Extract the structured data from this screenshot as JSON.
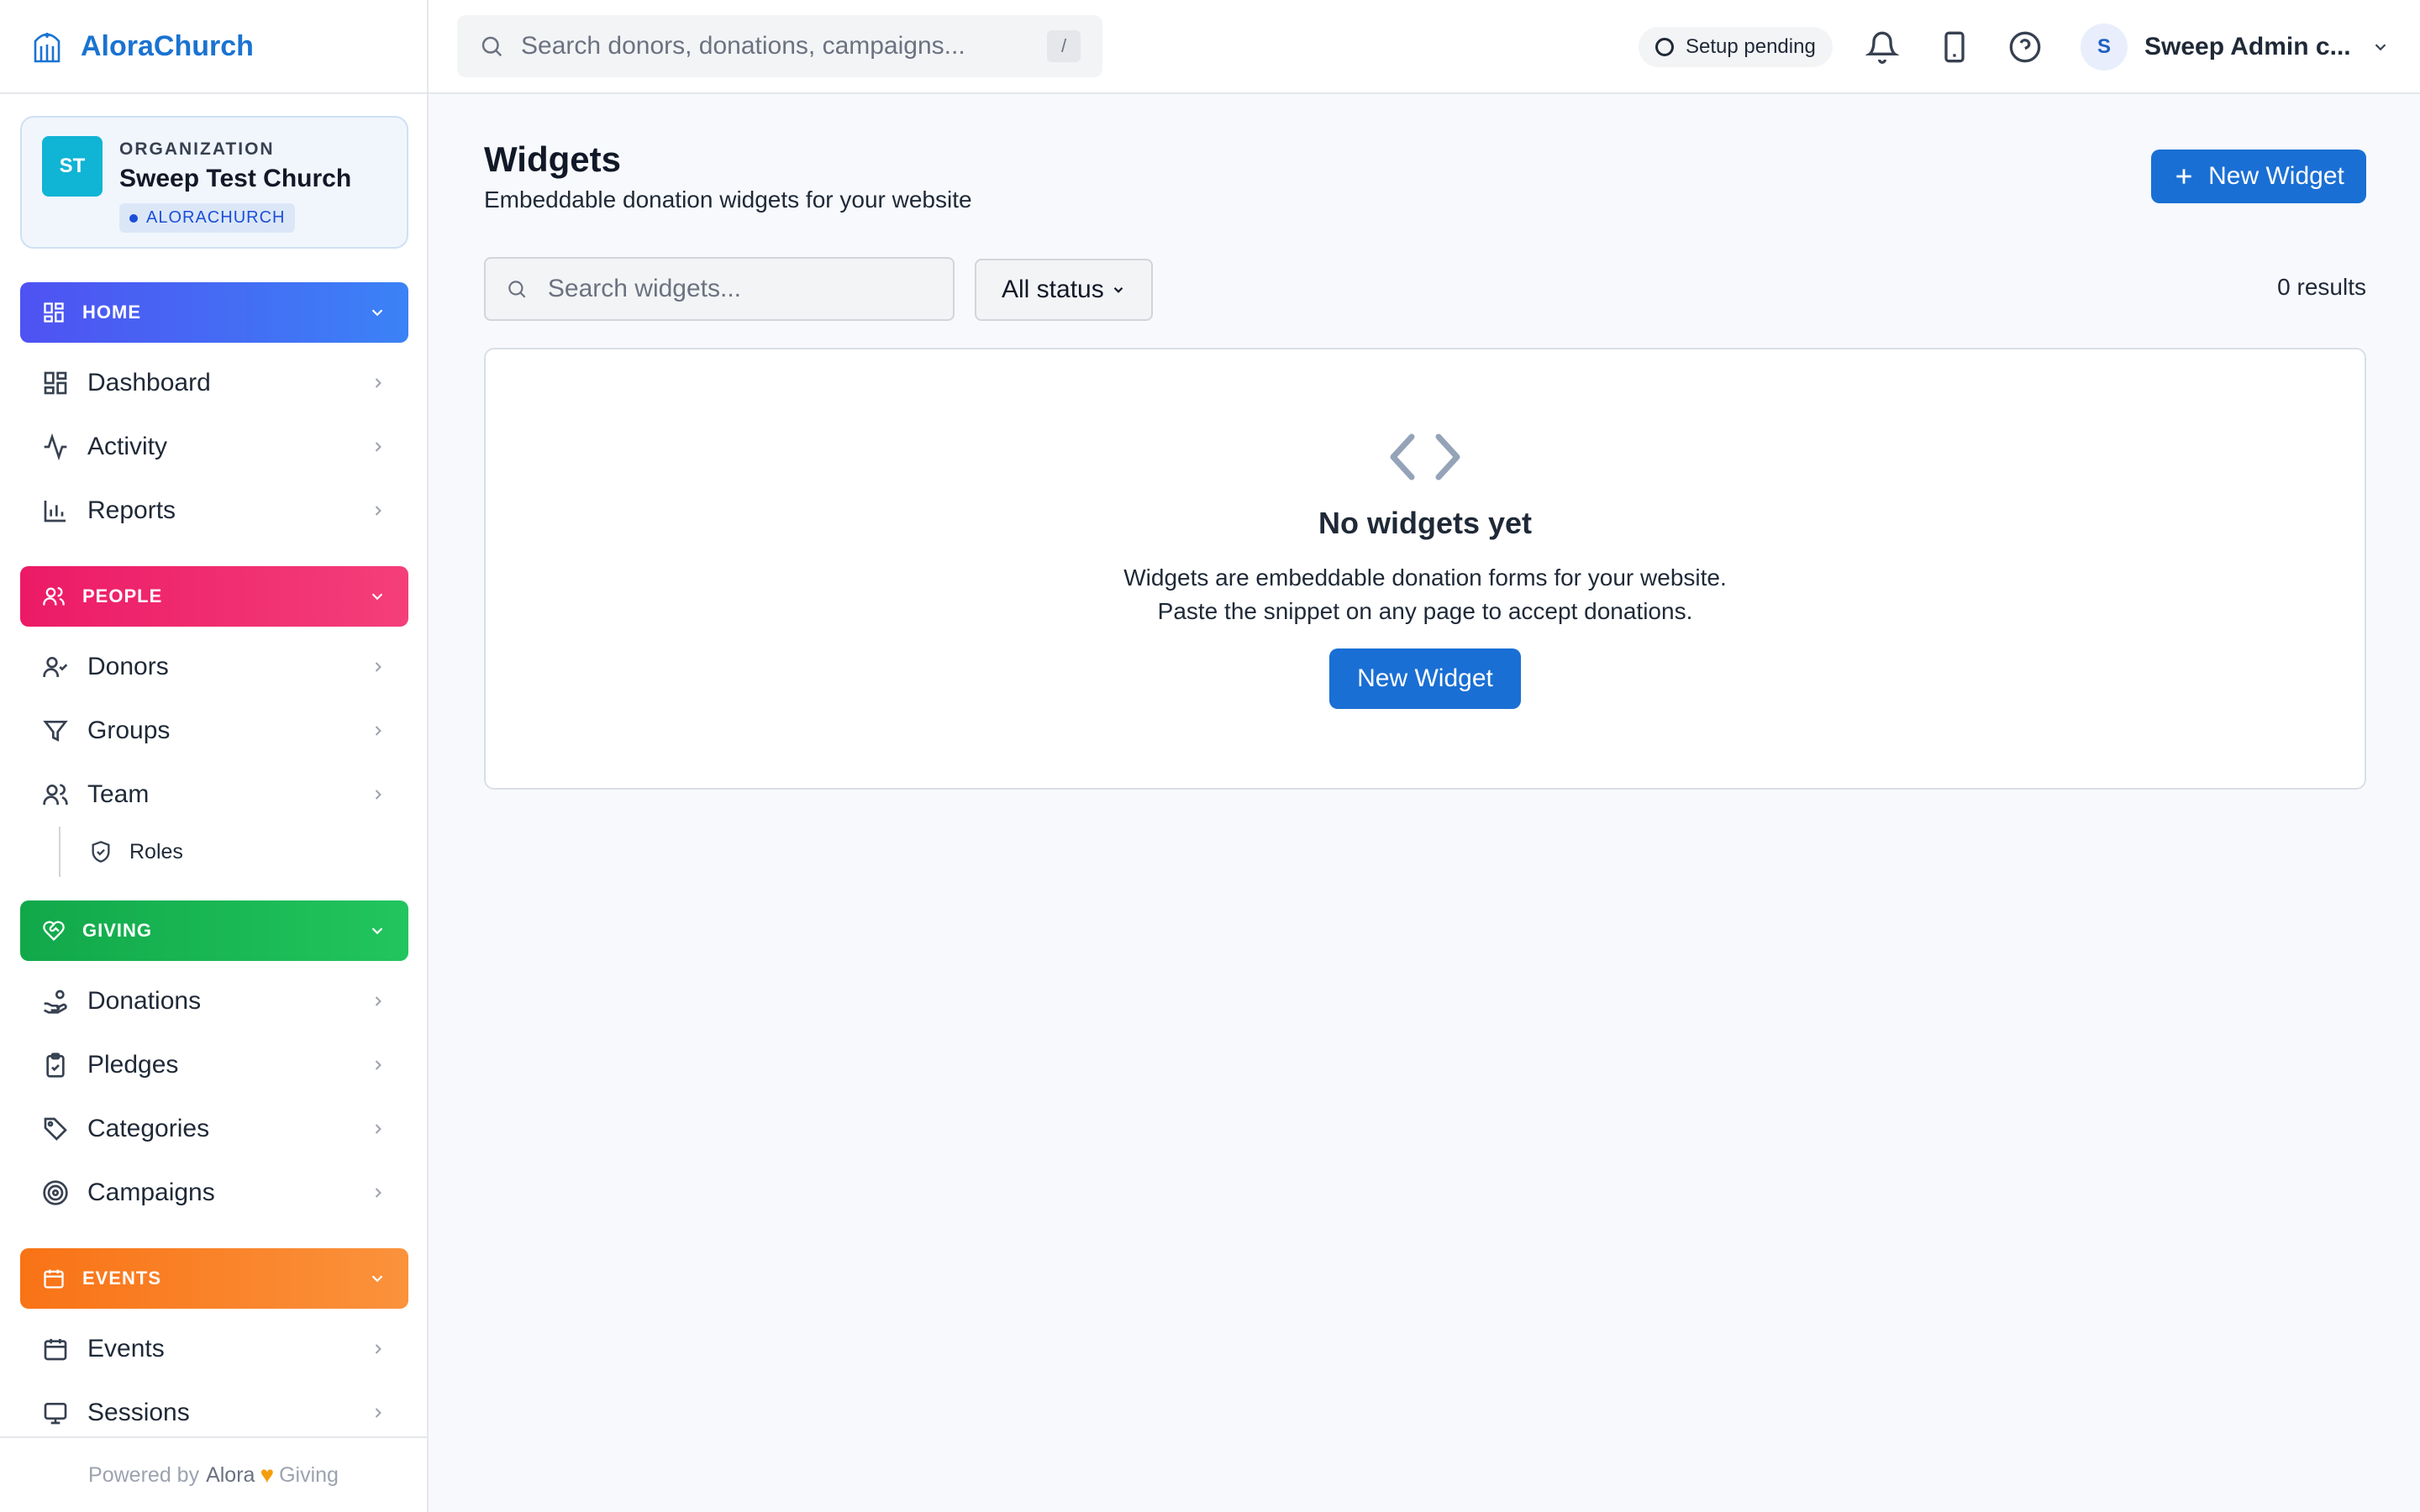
{
  "app": {
    "name": "AloraChurch"
  },
  "organization": {
    "initials": "ST",
    "label": "ORGANIZATION",
    "name": "Sweep Test Church",
    "badge": "ALORACHURCH"
  },
  "sidebar": {
    "sections": [
      {
        "label": "HOME",
        "icon": "grid-icon",
        "color": "#4f52f2",
        "items": [
          {
            "label": "Dashboard",
            "icon": "dashboard-icon"
          },
          {
            "label": "Activity",
            "icon": "activity-icon"
          },
          {
            "label": "Reports",
            "icon": "bar-chart-icon"
          }
        ]
      },
      {
        "label": "PEOPLE",
        "icon": "users-icon",
        "color": "#ec1a66",
        "items": [
          {
            "label": "Donors",
            "icon": "user-check-icon"
          },
          {
            "label": "Groups",
            "icon": "filter-icon"
          },
          {
            "label": "Team",
            "icon": "users-icon",
            "sub_items": [
              {
                "label": "Roles",
                "icon": "shield-check-icon"
              }
            ]
          }
        ]
      },
      {
        "label": "GIVING",
        "icon": "heart-handshake-icon",
        "color": "#11a84a",
        "items": [
          {
            "label": "Donations",
            "icon": "hand-coins-icon"
          },
          {
            "label": "Pledges",
            "icon": "clipboard-check-icon"
          },
          {
            "label": "Categories",
            "icon": "tag-icon"
          },
          {
            "label": "Campaigns",
            "icon": "target-icon"
          }
        ]
      },
      {
        "label": "EVENTS",
        "icon": "calendar-icon",
        "color": "#f97316",
        "items": [
          {
            "label": "Events",
            "icon": "calendar-icon"
          },
          {
            "label": "Sessions",
            "icon": "monitor-icon"
          }
        ]
      }
    ],
    "footer": {
      "powered_by": "Powered by",
      "brand_a": "Alora",
      "brand_b": "Giving"
    }
  },
  "topbar": {
    "search_placeholder": "Search donors, donations, campaigns...",
    "search_shortcut": "/",
    "setup_status": "Setup pending",
    "user_initial": "S",
    "user_name": "Sweep Admin c..."
  },
  "page": {
    "title": "Widgets",
    "subtitle": "Embeddable donation widgets for your website",
    "new_widget_label": "New Widget",
    "search_placeholder": "Search widgets...",
    "status_filter": "All status",
    "results": "0 results"
  },
  "empty_state": {
    "title": "No widgets yet",
    "line1": "Widgets are embeddable donation forms for your website.",
    "line2": "Paste the snippet on any page to accept donations.",
    "button": "New Widget"
  },
  "colors": {
    "primary": "#1a6fd4",
    "home": "#4f52f2",
    "people": "#ec1a66",
    "giving": "#11a84a",
    "events": "#f97316"
  }
}
